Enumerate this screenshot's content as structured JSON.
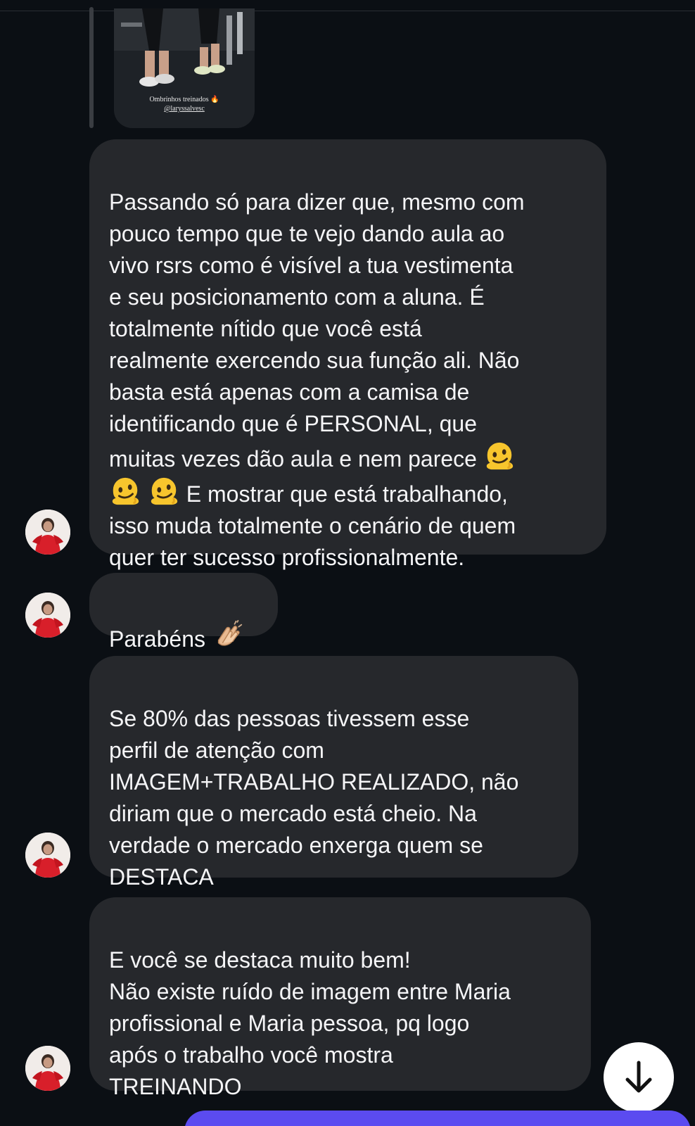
{
  "story_reply": {
    "caption_line1": "Ombrinhos treinados 🔥",
    "caption_handle": "@laryssalvesc"
  },
  "messages": [
    {
      "text": "Passando só para dizer que, mesmo com\npouco tempo que te vejo dando aula ao\nvivo rsrs como é visível a tua vestimenta\ne seu posicionamento com a aluna. É\ntotalmente nítido que você está\nrealmente exercendo sua função ali. Não\nbasta está apenas com a camisa de\nidentificando que é PERSONAL, que\nmuitas vezes dão aula e nem parece "
    },
    {
      "text_after_emojis": " E mostrar que está trabalhando,\nisso muda totalmente o cenário de quem\nquer ter sucesso profissionalmente."
    },
    {
      "text": "Parabéns "
    },
    {
      "text": "Se 80% das pessoas tivessem esse\nperfil de atenção com\nIMAGEM+TRABALHO REALIZADO, não\ndiriam que o mercado está cheio. Na\nverdade o mercado enxerga quem se\nDESTACA"
    },
    {
      "text": "E você se destaca muito bem!\nNão existe ruído de imagem entre Maria\nprofissional e Maria pessoa, pq logo\napós o trabalho você mostra\nTREINANDO"
    }
  ],
  "icons": {
    "melting_face": "melting-face-emoji",
    "clapping": "clapping-hands-emoji",
    "scroll": "arrow-down-icon"
  },
  "colors": {
    "background": "#0b0f14",
    "bubble": "#26282c",
    "composer": "#5b4bf0"
  }
}
